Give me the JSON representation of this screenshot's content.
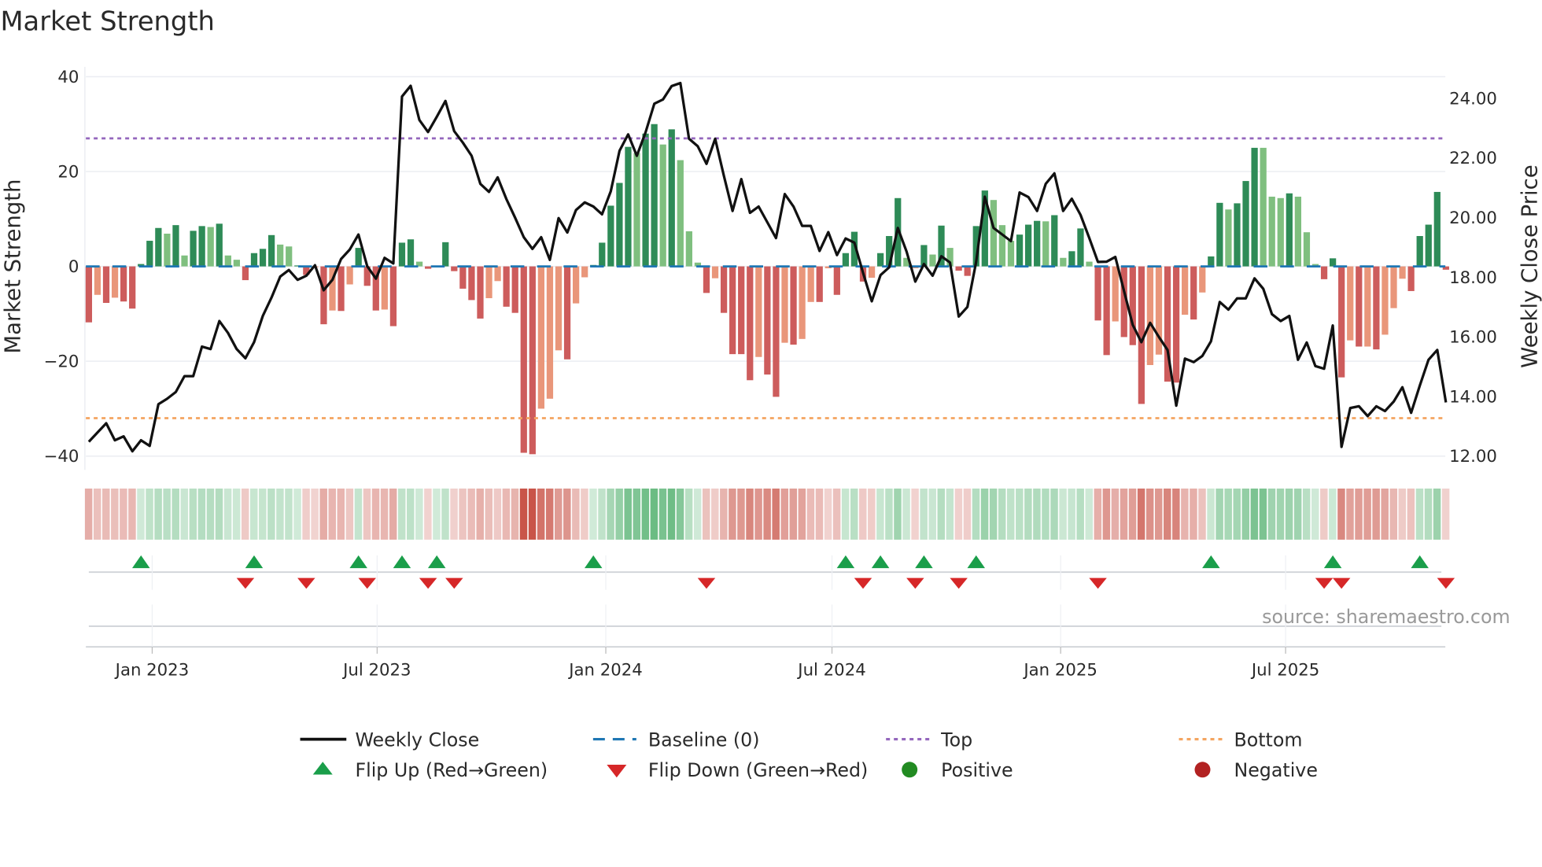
{
  "title": "Market Strength",
  "source": "source: sharemaestro.com",
  "colors": {
    "strong_positive": "#2e8b57",
    "weak_positive": "#7fbf7f",
    "strong_negative": "#cd5c5c",
    "weak_negative": "#e9967a",
    "close": "#111111",
    "baseline": "#1f77b4",
    "top": "#9467bd",
    "bottom": "#f4a460",
    "flip_up": "#1a9e4a",
    "flip_down": "#d62728",
    "positive": "#228b22",
    "negative": "#b22222"
  },
  "legend": {
    "weekly_close": "Weekly Close",
    "baseline": "Baseline (0)",
    "top": "Top",
    "bottom": "Bottom",
    "flip_up": "Flip Up (Red→Green)",
    "flip_down": "Flip Down (Green→Red)",
    "positive": "Positive",
    "negative": "Negative"
  },
  "chart_data": {
    "type": "bar",
    "title": "Market Strength",
    "ylabel": "Market Strength",
    "y2label": "Weekly Close Price",
    "ylim": [
      -42.9,
      42.1
    ],
    "y2lim": [
      11.54,
      25.05
    ],
    "yticks": [
      40,
      20,
      0,
      -20,
      -40
    ],
    "ytick_labels": [
      "40",
      "20",
      "0",
      "−20",
      "−40"
    ],
    "y2ticks": [
      24,
      22,
      20,
      18,
      16,
      14,
      12
    ],
    "y2tick_labels": [
      "24.00",
      "22.00",
      "20.00",
      "18.00",
      "16.00",
      "14.00",
      "12.00"
    ],
    "first_week": "2022-11-11",
    "xticks": [
      {
        "date": "2023-01-01",
        "label": "Jan 2023"
      },
      {
        "date": "2023-07-01",
        "label": "Jul 2023"
      },
      {
        "date": "2024-01-01",
        "label": "Jan 2024"
      },
      {
        "date": "2024-07-01",
        "label": "Jul 2024"
      },
      {
        "date": "2025-01-01",
        "label": "Jan 2025"
      },
      {
        "date": "2025-07-01",
        "label": "Jul 2025"
      }
    ],
    "baseline": 0,
    "top": 27,
    "bottom": -32,
    "strength": [
      -11.8,
      -6,
      -7.7,
      -6.6,
      -7.4,
      -8.9,
      0.5,
      5.4,
      8.1,
      6.9,
      8.7,
      2.3,
      7.5,
      8.5,
      8.3,
      9.0,
      2.3,
      1.4,
      -2.9,
      2.8,
      3.7,
      6.6,
      4.6,
      4.2,
      0.2,
      -1.8,
      -0.2,
      -12.2,
      -9.3,
      -9.4,
      -3.8,
      3.9,
      -4.1,
      -9.3,
      -9.1,
      -12.6,
      5.0,
      5.7,
      1.0,
      -0.5,
      0.1,
      5.1,
      -1,
      -4.7,
      -7.1,
      -11,
      -6.7,
      -3.1,
      -8.5,
      -9.8,
      -39.3,
      -39.6,
      -30,
      -27.9,
      -17.7,
      -19.6,
      -7.8,
      -2.3,
      0.3,
      5.0,
      12.8,
      17.6,
      25.2,
      23.9,
      28,
      30,
      25.7,
      28.9,
      22.4,
      7.4,
      0.8,
      -5.6,
      -2.5,
      -9.8,
      -18.5,
      -18.5,
      -24,
      -19.1,
      -22.8,
      -27.5,
      -16.1,
      -16.5,
      -15.3,
      -7.5,
      -7.5,
      -0.4,
      -6,
      2.8,
      7.3,
      -3.2,
      -2.4,
      2.8,
      6.4,
      14.4,
      1.8,
      -0.4,
      4.5,
      2.5,
      8.6,
      3.9,
      -0.9,
      -2,
      8.5,
      16,
      14,
      8.7,
      5.4,
      6.7,
      8.8,
      9.6,
      9.5,
      10.8,
      1.8,
      3.2,
      8,
      1,
      -11.4,
      -18.7,
      -11.6,
      -14.9,
      -16.6,
      -29,
      -20.8,
      -18.6,
      -24.3,
      -24.5,
      -10.2,
      -11.2,
      -5.5,
      2.1,
      13.4,
      12,
      13.3,
      18,
      25,
      25,
      14.7,
      14.4,
      15.4,
      14.7,
      7.2,
      0.5,
      -2.7,
      1.7,
      -23.4,
      -15.6,
      -16.9,
      -16.9,
      -17.5,
      -14.4,
      -8.8,
      -2.6,
      -5.2,
      6.4,
      8.8,
      15.7,
      -0.7
    ],
    "fading_weeks": [
      1,
      3,
      9,
      11,
      14,
      16,
      17,
      22,
      23,
      26,
      28,
      30,
      34,
      38,
      46,
      47,
      52,
      53,
      54,
      56,
      57,
      63,
      66,
      68,
      69,
      70,
      72,
      77,
      80,
      82,
      83,
      85,
      90,
      94,
      95,
      97,
      99,
      104,
      105,
      106,
      110,
      112,
      115,
      118,
      122,
      123,
      126,
      128,
      131,
      135,
      136,
      137,
      139,
      140,
      141,
      145,
      147,
      149,
      150,
      151
    ],
    "weekly_close": [
      12.48,
      12.79,
      13.1,
      12.53,
      12.66,
      12.16,
      12.53,
      12.34,
      13.74,
      13.92,
      14.15,
      14.68,
      14.68,
      15.67,
      15.59,
      16.53,
      16.13,
      15.59,
      15.28,
      15.82,
      16.7,
      17.32,
      18.02,
      18.24,
      17.91,
      18.05,
      18.4,
      17.56,
      17.91,
      18.61,
      18.93,
      19.43,
      18.37,
      17.95,
      18.65,
      18.46,
      24.06,
      24.42,
      23.27,
      22.87,
      23.38,
      23.91,
      22.9,
      22.51,
      22.07,
      21.13,
      20.86,
      21.35,
      20.62,
      20.0,
      19.34,
      18.95,
      19.34,
      18.58,
      19.98,
      19.5,
      20.25,
      20.51,
      20.37,
      20.11,
      20.88,
      22.24,
      22.79,
      22.07,
      22.86,
      23.82,
      23.96,
      24.41,
      24.51,
      22.64,
      22.39,
      21.8,
      22.64,
      21.41,
      20.22,
      21.29,
      20.16,
      20.37,
      19.84,
      19.31,
      20.79,
      20.37,
      19.72,
      19.72,
      18.88,
      19.51,
      18.74,
      19.3,
      19.16,
      18.15,
      17.19,
      18.07,
      18.33,
      19.65,
      18.86,
      17.85,
      18.44,
      18.05,
      18.7,
      18.49,
      16.68,
      17.0,
      18.51,
      20.7,
      19.65,
      19.43,
      19.21,
      20.84,
      20.69,
      20.22,
      21.13,
      21.48,
      20.22,
      20.63,
      20.09,
      19.31,
      18.51,
      18.52,
      18.68,
      17.54,
      16.4,
      15.82,
      16.47,
      16.0,
      15.56,
      13.69,
      15.27,
      15.15,
      15.36,
      15.85,
      17.17,
      16.91,
      17.29,
      17.29,
      17.96,
      17.61,
      16.76,
      16.53,
      16.7,
      15.23,
      15.81,
      15.02,
      14.93,
      16.38,
      12.31,
      13.61,
      13.67,
      13.34,
      13.67,
      13.51,
      13.83,
      14.31,
      13.45,
      14.36,
      15.23,
      15.56,
      13.8
    ],
    "flip_up_weeks": [
      6,
      19,
      31,
      36,
      40,
      58,
      87,
      91,
      96,
      102,
      129,
      143,
      153
    ],
    "flip_down_weeks": [
      18,
      25,
      32,
      39,
      42,
      71,
      89,
      95,
      100,
      116,
      142,
      144,
      156
    ],
    "legend_placement": "bottom-center"
  }
}
